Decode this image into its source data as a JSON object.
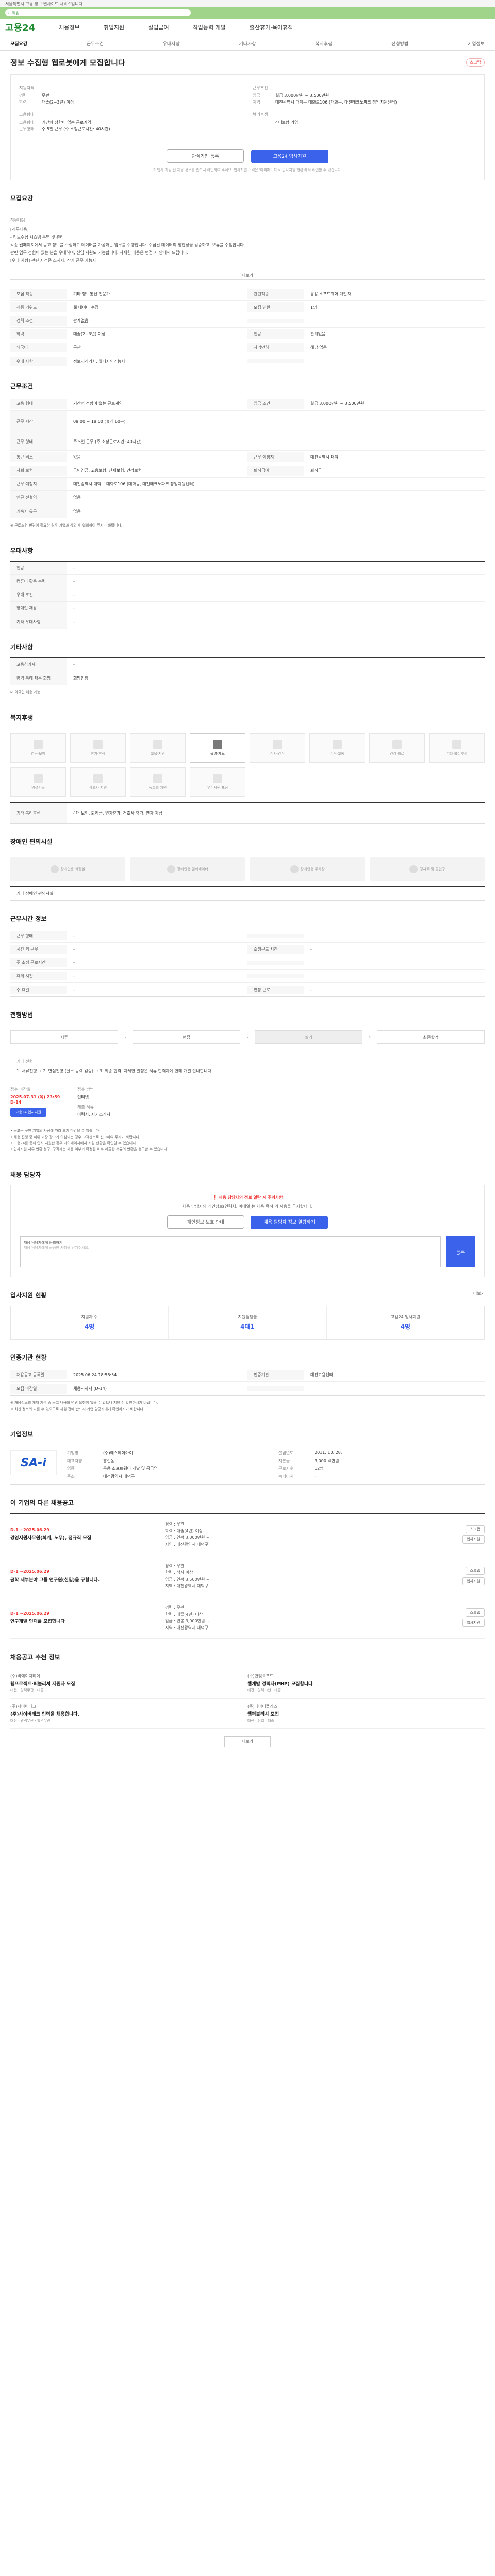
{
  "topbar": {
    "text": "서울특별시 고용 정보 웹사이트 서비스입니다"
  },
  "search": {
    "placeholder": "직업"
  },
  "header": {
    "logo": "고용24",
    "nav": [
      "채용정보",
      "취업지원",
      "실업급여",
      "직업능력 개발",
      "출산휴가·육아휴직"
    ]
  },
  "job_tabs": [
    "모집요강",
    "근무조건",
    "우대사항",
    "기타사항",
    "복지후생",
    "전형방법",
    "기업정보"
  ],
  "job": {
    "title": "정보 수집형 웹로봇에게 모집합니다",
    "scrap": "스크랩",
    "summary": {
      "left_label": "지원자격",
      "left": [
        {
          "k": "경력",
          "v": "무관"
        },
        {
          "k": "학력",
          "v": "대졸(2~3년) 이상"
        },
        {
          "k": "",
          "v": ""
        }
      ],
      "left_label2": "고용형태",
      "left2": [
        {
          "k": "고용형태",
          "v": "기간의 정함이 없는 근로계약"
        },
        {
          "k": "근무형태",
          "v": "주 5일 근무 (주 소정근로시간: 40시간)"
        }
      ],
      "right_label": "근무조건",
      "right": [
        {
          "k": "임금",
          "v": "월급 3,000만원 ~ 3,500만원"
        },
        {
          "k": "지역",
          "v": "대전광역시 대덕구 대화로106 (대화동, 대전테크노파크 창업지원센터)"
        }
      ],
      "right_label2": "복리후생",
      "right2": [
        {
          "k": "",
          "v": "4대보험 가입"
        }
      ]
    },
    "buttons": {
      "interest": "관심기업 등록",
      "apply": "고용24 입사지원"
    },
    "apply_note": "※ 입사 지원 전 채용 정보를 반드시 확인하여 주세요. 입사지원 이력은 '마이페이지 > 입사지원 현황'에서 확인할 수 있습니다."
  },
  "recruit": {
    "title": "모집요강",
    "sub_label": "직무내용",
    "text": [
      "[직무내용]",
      "- 정보수집 시스템 운영 및 관리",
      "각종 웹페이지에서 공고 정보를 수집하고 데이터를 가공하는 업무를 수행합니다. 수집된 데이터의 정합성을 검증하고, 오류를 수정합니다.",
      "관련 업무 경험이 있는 분을 우대하며, 신입 지원도 가능합니다. 자세한 내용은 면접 시 안내해 드립니다.",
      "",
      "[우대 사항] 관련 자격증 소지자, 장기 근무 가능자"
    ],
    "more": "더보기",
    "rows": [
      {
        "th": "모집 직종",
        "td": "기타 정보통신 전문가",
        "th2": "관련직종",
        "td2": "응용 소프트웨어 개발자"
      },
      {
        "th": "직종 키워드",
        "td": "웹 데이터 수집",
        "th2": "모집 인원",
        "td2": "1명"
      },
      {
        "th": "경력 조건",
        "td": "관계없음",
        "th2": "",
        "td2": ""
      },
      {
        "th": "학력",
        "td": "대졸(2~3년) 이상",
        "th2": "전공",
        "td2": "관계없음"
      },
      {
        "th": "외국어",
        "td": "무관",
        "th2": "자격면허",
        "td2": "해당 없음"
      },
      {
        "th": "우대 사항",
        "td": "정보처리기사, 웹디자인기능사",
        "th2": "",
        "td2": ""
      }
    ]
  },
  "conditions": {
    "title": "근무조건",
    "rows": [
      {
        "th": "고용 형태",
        "td": "기간의 정함이 없는 근로계약",
        "th2": "임금 조건",
        "td2": "월급 3,000만원 ~ 3,500만원"
      },
      {
        "th": "근무 시간",
        "td": "09:00 ~ 18:00 (휴게 60분)",
        "th2": "",
        "td2": ""
      },
      {
        "th": "근무 형태",
        "td": "주 5일 근무 (주 소정근로시간: 40시간)",
        "th2": "",
        "td2": ""
      },
      {
        "th": "통근 버스",
        "td": "없음",
        "th2": "근무 예정지",
        "td2": "대전광역시 대덕구"
      },
      {
        "th": "사회 보험",
        "td": "국민연금, 고용보험, 산재보험, 건강보험",
        "th2": "퇴직급여",
        "td2": "퇴직금"
      },
      {
        "th": "근무 예정지",
        "td": "대전광역시 대덕구 대화로106 (대화동, 대전테크노파크 창업지원센터)",
        "th2": "",
        "td2": ""
      },
      {
        "th": "인근 전철역",
        "td": "없음",
        "th2": "",
        "td2": ""
      },
      {
        "th": "기숙사 유무",
        "td": "없음",
        "th2": "",
        "td2": ""
      }
    ],
    "note": "※ 근로조건 변경이 필요한 경우 기업과 상의 후 협의하여 주시기 바랍니다."
  },
  "preference": {
    "title": "우대사항",
    "rows": [
      {
        "th": "전공",
        "td": "-"
      },
      {
        "th": "컴퓨터 활용 능력",
        "td": "-"
      },
      {
        "th": "우대 조건",
        "td": "-"
      },
      {
        "th": "장애인 채용",
        "td": "-"
      },
      {
        "th": "기타 우대사항",
        "td": "-"
      }
    ]
  },
  "etc": {
    "title": "기타사항",
    "rows": [
      {
        "th": "고용허가제",
        "td": "-"
      },
      {
        "th": "병역 특례 채용 희망",
        "td": "희망안함"
      }
    ],
    "extra": "외국인 채용 가능"
  },
  "welfare": {
    "title": "복지후생",
    "items": [
      {
        "label": "연금·보험",
        "on": false
      },
      {
        "label": "휴가·휴직",
        "on": false
      },
      {
        "label": "교육·지원",
        "on": false
      },
      {
        "label": "급여·제도",
        "on": true
      },
      {
        "label": "식사·간식",
        "on": false
      },
      {
        "label": "주거·교통",
        "on": false
      },
      {
        "label": "건강·의료",
        "on": false
      },
      {
        "label": "기타 복리후생",
        "on": false
      },
      {
        "label": "명절선물",
        "on": false
      },
      {
        "label": "경조사 지원",
        "on": false
      },
      {
        "label": "동호회 지원",
        "on": false
      },
      {
        "label": "우수사원 포상",
        "on": false
      }
    ],
    "rows": [
      {
        "th": "기타 복리후생",
        "td": "4대 보험, 퇴직금, 연차휴가, 경조사 휴가, 연차 지급"
      }
    ]
  },
  "disability": {
    "title": "장애인 편의시설",
    "items": [
      "장애인용 화장실",
      "장애인용 엘리베이터",
      "장애인용 주차장",
      "경사로 및 출입구"
    ],
    "note": "기타 장애인 편의시설"
  },
  "worktime": {
    "title": "근무시간 정보",
    "rows": [
      {
        "th": "근무 형태",
        "td": "-",
        "th2": "",
        "td2": ""
      },
      {
        "th": "시간 외 근무",
        "td": "-",
        "th2": "소정근로 시간",
        "td2": "-"
      },
      {
        "th": "주 소정 근로시간",
        "td": "-",
        "th2": "",
        "td2": ""
      },
      {
        "th": "휴게 시간",
        "td": "-",
        "th2": "",
        "td2": ""
      },
      {
        "th": "주 휴일",
        "td": "-",
        "th2": "연장 근로",
        "td2": "-"
      }
    ]
  },
  "process": {
    "title": "전형방법",
    "steps": [
      "서류",
      "면접",
      "필기",
      "최종합격"
    ]
  },
  "method": {
    "label": "기타 전형",
    "text": "1. 서류전형 → 2. 면접전형 (실무 능력 검증) → 3. 최종 합격. 자세한 일정은 서류 합격자에 한해 개별 안내합니다.",
    "deadline_label": "접수 마감일",
    "deadline": "2025.07.31 (목) 23:59",
    "dday": "D-14",
    "apply_btn": "고용24 입사지원",
    "method_label": "접수 방법",
    "method_value": "인터넷",
    "docs_label": "제출 서류",
    "docs_value": "이력서, 자기소개서",
    "notices": [
      "• 공고는 구인 기업의 사정에 따라 조기 마감될 수 있습니다.",
      "• 채용 진행 중 허위·과장 광고가 의심되는 경우 고객센터로 신고하여 주시기 바랍니다.",
      "• 고용24를 통해 입사 지원한 경우 마이페이지에서 지원 현황을 확인할 수 있습니다.",
      "• 입사지원 서류 반환 청구: 구직자는 채용 여부가 확정된 이후 제출한 서류의 반환을 청구할 수 있습니다."
    ]
  },
  "consult": {
    "title": "채용 담당자",
    "alert": "채용 담당자의 정보 열람 시 주의사항",
    "text": "채용 담당자의 개인정보(연락처, 이메일)는 채용 목적 외 사용을 금지합니다.",
    "btn1": "개인정보 보호 안내",
    "btn2": "채용 담당자 정보 열람하기",
    "qna_label": "채용 담당자에게 문의하기",
    "qna_placeholder": "채용 담당자에게 궁금한 사항을 남겨주세요.",
    "qna_btn": "등록"
  },
  "stats": {
    "title": "입사지원 현황",
    "more": "더보기",
    "items": [
      {
        "label": "지원자 수",
        "value": "4명"
      },
      {
        "label": "지원경쟁률",
        "value": "4대1"
      },
      {
        "label": "고용24 입사지원",
        "value": "4명"
      }
    ]
  },
  "info_rows": {
    "title": "인증기관 현황",
    "rows": [
      {
        "th": "채용공고 등록일",
        "td": "2025.06.24 18:58:54",
        "th2": "인증기관",
        "td2": "대전고용센터"
      },
      {
        "th": "모집 마감일",
        "td": "채용시까지 (D-14)",
        "th2": "",
        "td2": ""
      }
    ],
    "notes": [
      "※ 채용정보의 게재 기간 중 공고 내용의 변경 요청이 있을 수 있으니 지원 전 확인하시기 바랍니다.",
      "※ 최신 정보와 다를 수 있으므로 지원 전에 반드시 기업 담당자에게 확인하시기 바랍니다."
    ]
  },
  "company": {
    "title": "기업정보",
    "logo_text": "SA-i",
    "fields": [
      {
        "k": "기업명",
        "v": "(주)에스에이아이"
      },
      {
        "k": "설립년도",
        "v": "2011. 10. 28."
      },
      {
        "k": "대표자명",
        "v": "홍길동"
      },
      {
        "k": "자본금",
        "v": "3,000 백만원"
      },
      {
        "k": "업종",
        "v": "응용 소프트웨어 개발 및 공급업"
      },
      {
        "k": "근로자수",
        "v": "12명"
      },
      {
        "k": "주소",
        "v": "대전광역시 대덕구"
      },
      {
        "k": "홈페이지",
        "v": "-"
      }
    ]
  },
  "similar": {
    "title": "이 기업의 다른 채용공고",
    "jobs": [
      {
        "dday": "D-1 ~2025.06.29",
        "title": "경영지원사무원(회계, 노무), 정규직 모집",
        "info": [
          "경력 : 무관",
          "학력 : 대졸(4년) 이상",
          "임금 : 연봉 3,000만원 ~",
          "지역 : 대전광역시 대덕구"
        ]
      },
      {
        "dday": "D-1 ~2025.06.29",
        "title": "공학 세부분야 그룹 연구원(신입)을 구합니다.",
        "info": [
          "경력 : 무관",
          "학력 : 석사 이상",
          "임금 : 연봉 3,500만원 ~",
          "지역 : 대전광역시 대덕구"
        ]
      },
      {
        "dday": "D-1 ~2025.06.29",
        "title": "연구개발 인재를 모집합니다",
        "info": [
          "경력 : 무관",
          "학력 : 대졸(4년) 이상",
          "임금 : 연봉 3,000만원 ~",
          "지역 : 대전광역시 대덕구"
        ]
      }
    ],
    "btn_scrap": "스크랩",
    "btn_apply": "입사지원"
  },
  "recommend": {
    "title": "채용공고 추천 정보",
    "cards": [
      {
        "co": "(주)비에이치티이",
        "title": "웹프로젝트·퍼블리셔 지원자 모집",
        "meta": "대전 · 경력무관 · 대졸"
      },
      {
        "co": "(주)한빛소프트",
        "title": "웹개발 경력자(PHP) 모집합니다",
        "meta": "대전 · 경력 3년 · 대졸"
      },
      {
        "co": "(주)사이버테크",
        "title": "(주)사이버테크 인력을 채용합니다.",
        "meta": "대전 · 경력무관 · 학력무관"
      },
      {
        "co": "(주)데이터플러스",
        "title": "웹퍼블리셔 모집",
        "meta": "대전 · 신입 · 대졸"
      }
    ],
    "more": "더보기"
  }
}
